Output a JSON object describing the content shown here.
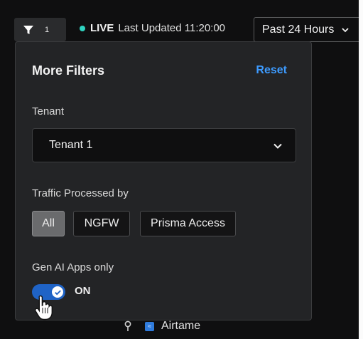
{
  "toolbar": {
    "filter_count": "1",
    "live_label": "LIVE",
    "last_updated": "Last Updated 11:20:00",
    "time_range": "Past 24 Hours"
  },
  "filters_panel": {
    "title": "More Filters",
    "reset_label": "Reset",
    "tenant": {
      "label": "Tenant",
      "selected": "Tenant 1"
    },
    "traffic": {
      "label": "Traffic Processed by",
      "options": [
        "All",
        "NGFW",
        "Prisma Access"
      ],
      "selected": "All"
    },
    "gen_ai": {
      "label": "Gen AI Apps only",
      "toggle_state": "ON",
      "enabled": true
    }
  },
  "background": {
    "app_name": "Airtame"
  },
  "colors": {
    "accent": "#3d9bff",
    "toggle_on": "#1f63c6",
    "live": "#2fd3c0",
    "panel_bg": "#232426"
  },
  "icons": {
    "filter": "filter-icon",
    "dropdown": "chevron-down-icon",
    "check": "check-icon",
    "cursor": "hand-pointer-icon",
    "pin": "location-pin-icon",
    "app": "app-icon"
  }
}
